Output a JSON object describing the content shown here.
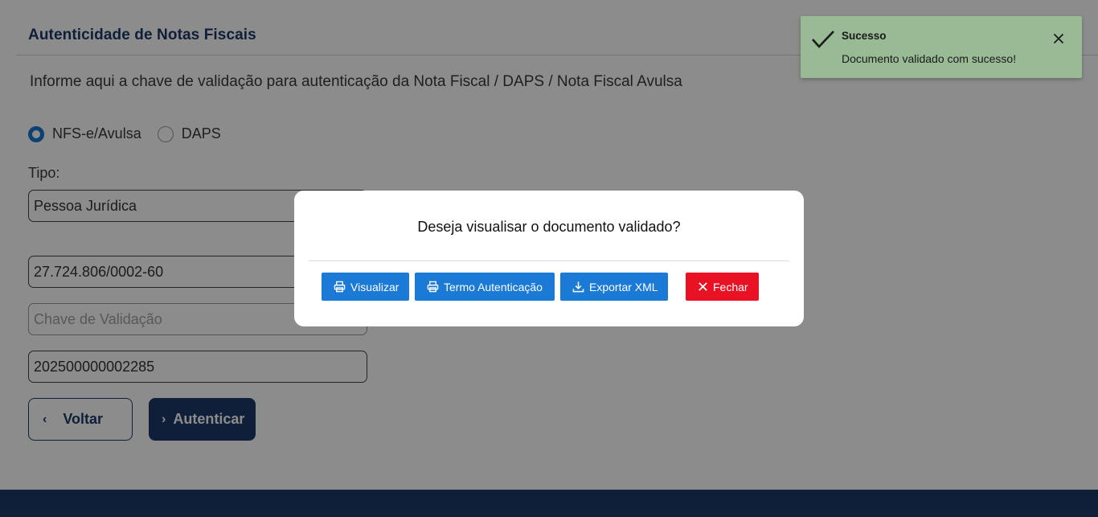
{
  "page": {
    "title": "Autenticidade de Notas Fiscais",
    "instruction": "Informe aqui a chave de validação para autenticação da Nota Fiscal / DAPS / Nota Fiscal Avulsa"
  },
  "document_type": {
    "options": [
      {
        "label": "NFS-e/Avulsa",
        "selected": true
      },
      {
        "label": "DAPS",
        "selected": false
      }
    ]
  },
  "form": {
    "tipo_label": "Tipo:",
    "tipo_value": "Pessoa Jurídica",
    "documento_value": "27.724.806/0002-60",
    "chave_placeholder": "Chave de Validação",
    "numero_value": "202500000002285",
    "back_label": "Voltar",
    "submit_label": "Autenticar"
  },
  "modal": {
    "question": "Deseja visualisar o documento validado?",
    "buttons": {
      "visualizar": "Visualizar",
      "termo": "Termo Autenticação",
      "exportar": "Exportar XML",
      "fechar": "Fechar"
    }
  },
  "toast": {
    "title": "Sucesso",
    "message": "Documento validado com sucesso!"
  },
  "colors": {
    "brand": "#1e3a68",
    "modal_button": "#1a7ad6",
    "close_button": "#e81224",
    "toast_bg": "#98bb96"
  },
  "icons": [
    "printer-icon",
    "download-icon",
    "close-icon",
    "check-icon",
    "chevron-left-icon",
    "chevron-right-icon"
  ]
}
